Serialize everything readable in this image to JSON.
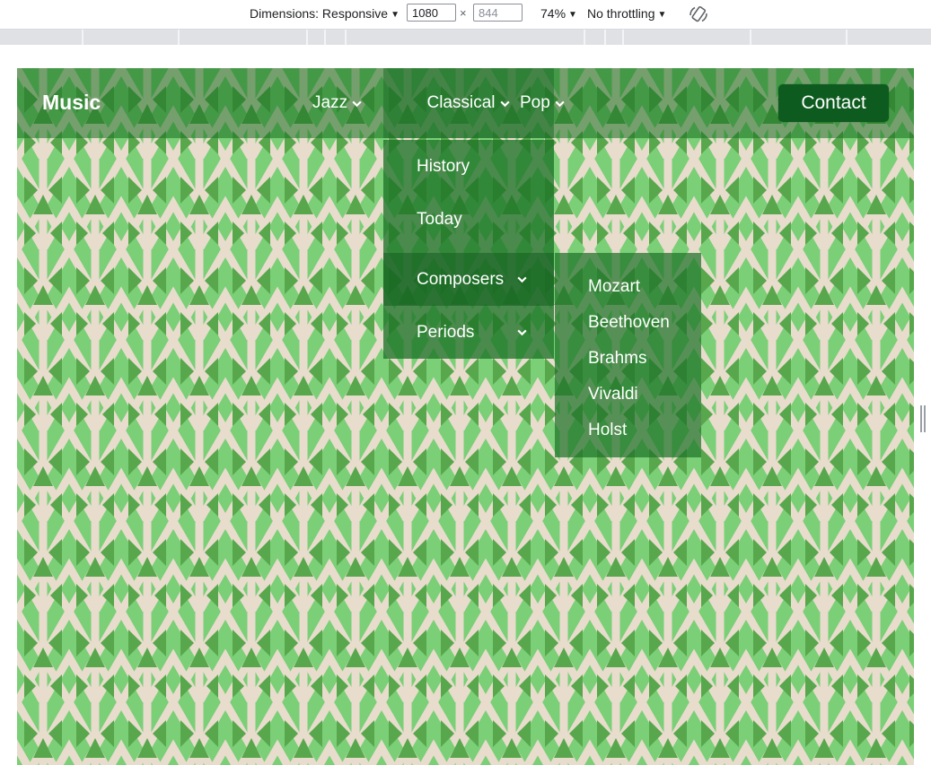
{
  "devtools": {
    "dimensions_label": "Dimensions: Responsive",
    "width_value": "1080",
    "height_placeholder": "844",
    "zoom": "74%",
    "throttling": "No throttling",
    "rotate_icon": "rotate-icon"
  },
  "site": {
    "logo": "Music",
    "nav": [
      {
        "label": "Jazz"
      },
      {
        "label": "Classical"
      },
      {
        "label": "Pop"
      }
    ],
    "contact_label": "Contact",
    "classical_menu": [
      {
        "label": "History"
      },
      {
        "label": "Today"
      },
      {
        "label": "Composers"
      },
      {
        "label": "Periods"
      }
    ],
    "composers_menu": [
      {
        "label": "Mozart"
      },
      {
        "label": "Beethoven"
      },
      {
        "label": "Brahms"
      },
      {
        "label": "Vivaldi"
      },
      {
        "label": "Holst"
      }
    ]
  },
  "colors": {
    "pattern_cream": "#e8dccd",
    "pattern_light_green": "#7acf77",
    "pattern_dark_green": "#58a74c",
    "contact_button": "#0e5b1f"
  }
}
